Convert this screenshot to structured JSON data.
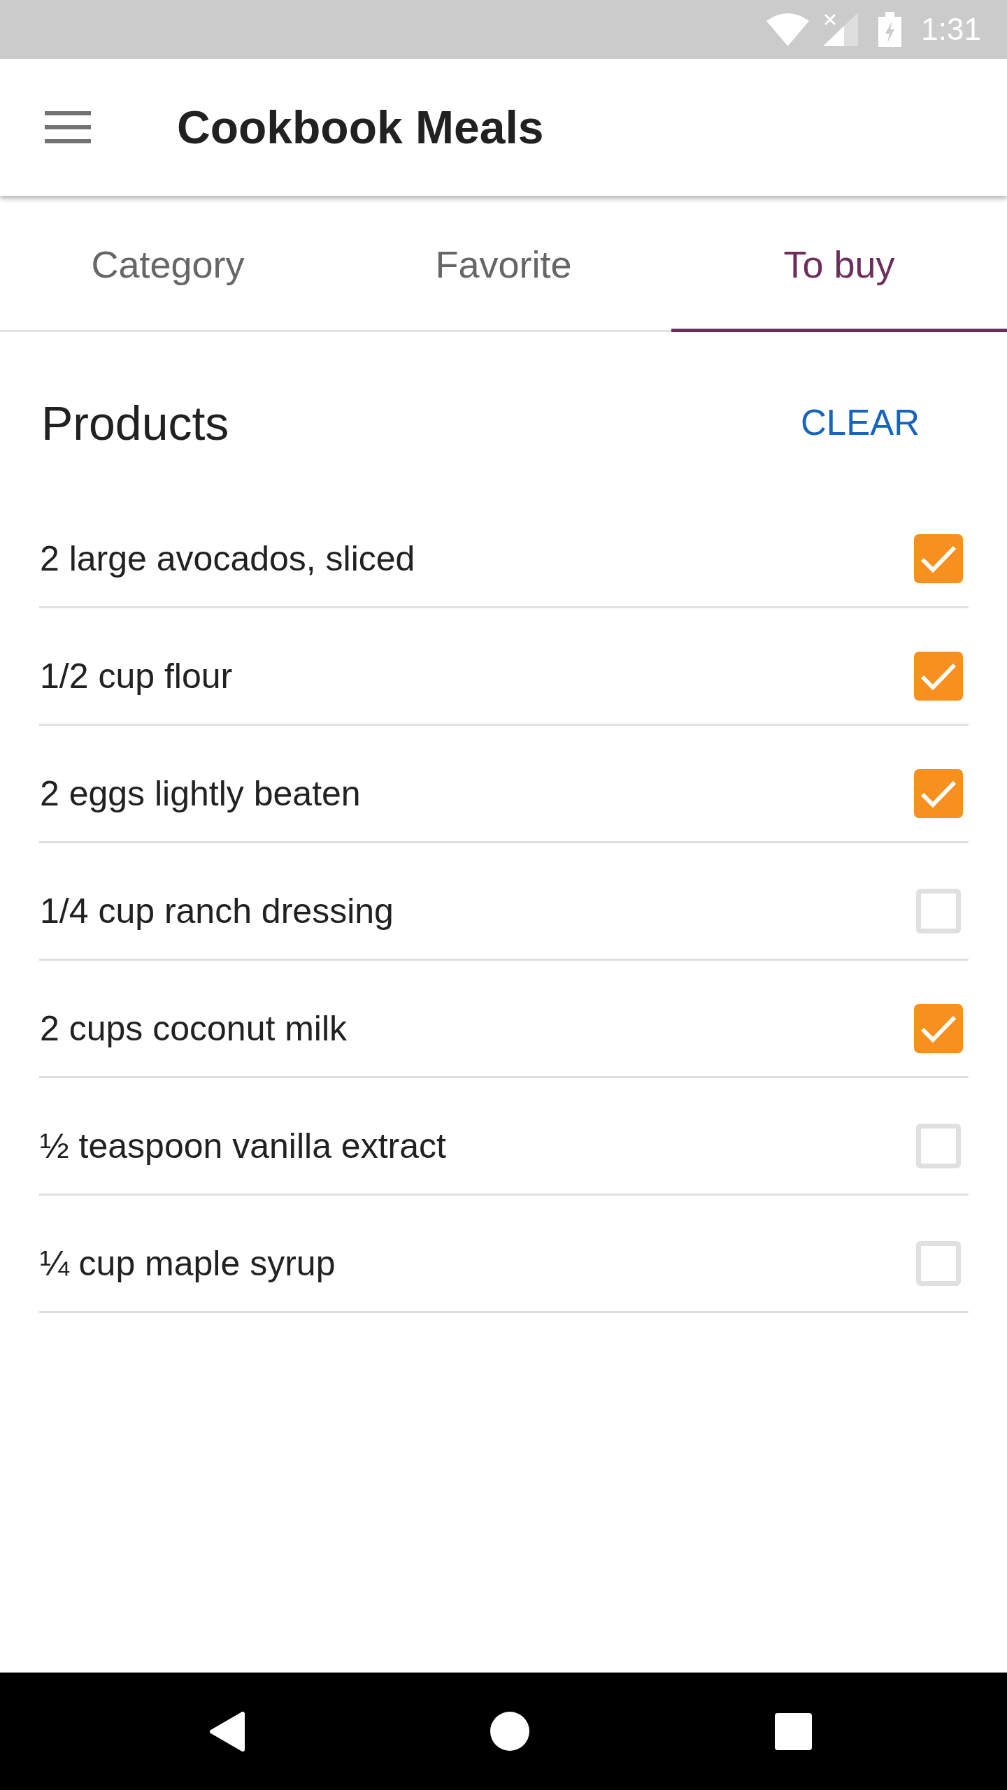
{
  "status_bar": {
    "time": "1:31"
  },
  "app_bar": {
    "title": "Cookbook Meals"
  },
  "tabs": [
    {
      "label": "Category",
      "selected": false
    },
    {
      "label": "Favorite",
      "selected": false
    },
    {
      "label": "To buy",
      "selected": true
    }
  ],
  "products": {
    "title": "Products",
    "action": "CLEAR",
    "items": [
      {
        "name": "2 large avocados, sliced",
        "checked": true
      },
      {
        "name": "1/2 cup flour",
        "checked": true
      },
      {
        "name": "2 eggs lightly beaten",
        "checked": true
      },
      {
        "name": "1/4 cup ranch dressing",
        "checked": false
      },
      {
        "name": "2 cups coconut milk",
        "checked": true
      },
      {
        "name": "½ teaspoon vanilla extract",
        "checked": false
      },
      {
        "name": "¼ cup maple syrup",
        "checked": false
      }
    ]
  }
}
